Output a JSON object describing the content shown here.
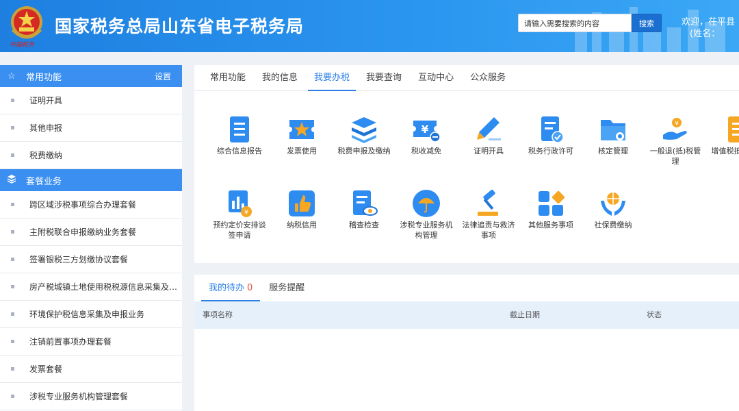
{
  "header": {
    "title": "国家税务总局山东省电子税务局",
    "emblem_caption": "中国税务",
    "search_placeholder": "请输入需要搜索的内容",
    "search_button": "搜索",
    "welcome": "欢迎，茌平县",
    "name_label": "(姓名："
  },
  "sidebar": {
    "common": {
      "title": "常用功能",
      "settings": "设置",
      "icon": "star-icon",
      "items": [
        "证明开具",
        "其他申报",
        "税费缴纳"
      ]
    },
    "packages": {
      "title": "套餐业务",
      "icon": "layers-icon",
      "items": [
        "跨区域涉税事项综合办理套餐",
        "主附税联合申报缴纳业务套餐",
        "签署银税三方划缴协议套餐",
        "房产税城镇土地使用税税源信息采集及申...",
        "环境保护税信息采集及申报业务",
        "注销前置事项办理套餐",
        "发票套餐",
        "涉税专业服务机构管理套餐"
      ]
    }
  },
  "tabs": [
    "常用功能",
    "我的信息",
    "我要办税",
    "我要查询",
    "互动中心",
    "公众服务"
  ],
  "active_tab": "我要办税",
  "services": [
    {
      "label": "综合信息报告",
      "icon": "document-icon"
    },
    {
      "label": "发票使用",
      "icon": "ticket-star-icon"
    },
    {
      "label": "税费申报及缴纳",
      "icon": "stack-icon"
    },
    {
      "label": "税收减免",
      "icon": "yuan-ticket-icon"
    },
    {
      "label": "证明开具",
      "icon": "pen-icon"
    },
    {
      "label": "税务行政许可",
      "icon": "approved-doc-icon"
    },
    {
      "label": "核定管理",
      "icon": "folder-icon"
    },
    {
      "label": "一般退(抵)税管理",
      "icon": "coin-hand-icon"
    },
    {
      "label": "增值税抵扣凭证",
      "icon": "receipt-icon"
    },
    {
      "label": "预约定价安排谈签申请",
      "icon": "chart-yuan-icon"
    },
    {
      "label": "纳税信用",
      "icon": "thumbs-up-icon"
    },
    {
      "label": "稽查检查",
      "icon": "inspect-icon"
    },
    {
      "label": "涉税专业服务机构管理",
      "icon": "umbrella-icon"
    },
    {
      "label": "法律追责与救济事项",
      "icon": "gavel-icon"
    },
    {
      "label": "其他服务事项",
      "icon": "blocks-icon"
    },
    {
      "label": "社保费缴纳",
      "icon": "globe-hands-icon"
    }
  ],
  "todo": {
    "tabs": [
      "我的待办",
      "服务提醒"
    ],
    "count": "0",
    "columns": [
      "事项名称",
      "截止日期",
      "状态"
    ]
  },
  "colors": {
    "accent": "#2b7fe6",
    "header": "#2a8fee",
    "sidebar_head": "#3a8ff0"
  }
}
